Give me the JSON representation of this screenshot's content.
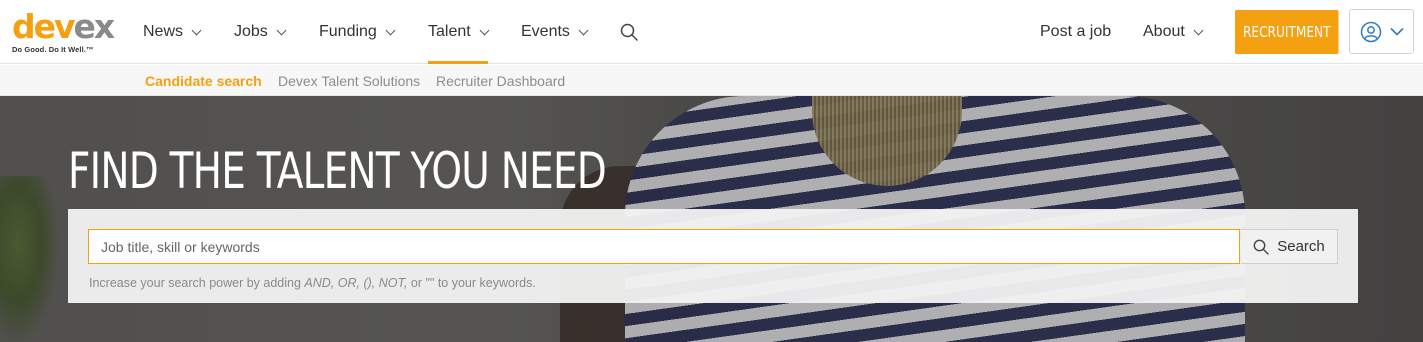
{
  "logo": {
    "part1": "dev",
    "part2": "ex",
    "tagline": "Do Good. Do It Well.™"
  },
  "nav": {
    "items": [
      {
        "label": "News",
        "has_dropdown": true,
        "active": false
      },
      {
        "label": "Jobs",
        "has_dropdown": true,
        "active": false
      },
      {
        "label": "Funding",
        "has_dropdown": true,
        "active": false
      },
      {
        "label": "Talent",
        "has_dropdown": true,
        "active": true
      },
      {
        "label": "Events",
        "has_dropdown": true,
        "active": false
      }
    ],
    "search_icon": "search-icon",
    "post_job": "Post a job",
    "about": "About",
    "recruitment": "RECRUITMENT",
    "account_icon": "user-circle-icon"
  },
  "subnav": {
    "items": [
      {
        "label": "Candidate search",
        "active": true
      },
      {
        "label": "Devex Talent Solutions",
        "active": false
      },
      {
        "label": "Recruiter Dashboard",
        "active": false
      }
    ]
  },
  "hero": {
    "title": "FIND THE TALENT YOU NEED",
    "search": {
      "placeholder": "Job title, skill or keywords",
      "value": "",
      "button": "Search"
    },
    "hint": {
      "prefix": "Increase your search power by adding ",
      "operators": "AND, OR, (), NOT,",
      "middle": " or ",
      "quotes": "\"\"",
      "suffix": " to your keywords."
    }
  },
  "colors": {
    "accent": "#f5a011",
    "logo_gray": "#8a8a8a",
    "text": "#333333"
  }
}
